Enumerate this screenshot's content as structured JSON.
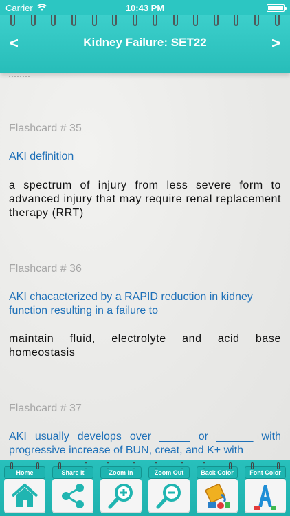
{
  "status": {
    "carrier": "Carrier",
    "time": "10:43 PM",
    "wifi_icon": "wifi-icon",
    "battery_icon": "battery-icon"
  },
  "nav": {
    "title": "Kidney Failure: SET22",
    "prev_icon": "chevron-left-icon",
    "next_icon": "chevron-right-icon",
    "prev_glyph": "<",
    "next_glyph": ">"
  },
  "colors": {
    "teal": "#2cc6c2",
    "question_blue": "#1e70b8",
    "number_gray": "#a6a6a6"
  },
  "cards": [
    {
      "number": "Flashcard # 35",
      "question": "AKI definition",
      "answer": "a spectrum of injury from less severe form to advanced injury that may require renal replacement therapy (RRT)"
    },
    {
      "number": "Flashcard # 36",
      "question": "AKI chacacterized by a RAPID reduction in kidney function resulting in a failure to",
      "answer": "maintain fluid, electrolyte and acid base homeostasis"
    },
    {
      "number": "Flashcard # 37",
      "question": "AKI usually develops over _____ or ______ with progressive increase of BUN, creat, and K+ with",
      "answer": ""
    }
  ],
  "toolbar": {
    "home": "Home",
    "share": "Share it",
    "zoom_in": "Zoom In",
    "zoom_out": "Zoom Out",
    "back_color": "Back Color",
    "font_color": "Font Color"
  }
}
